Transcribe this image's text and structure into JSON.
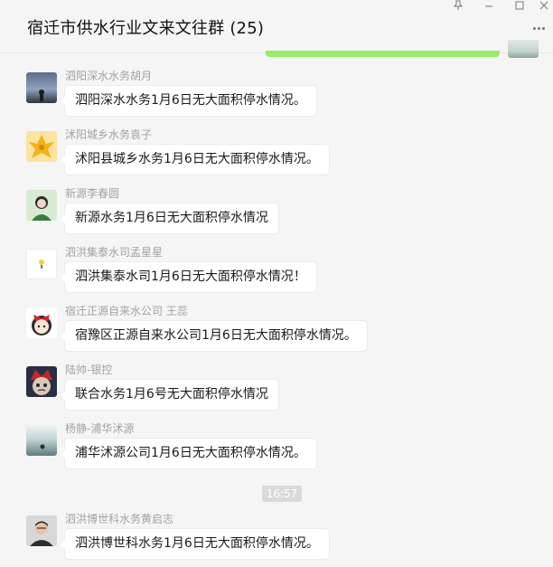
{
  "window": {
    "title": "宿迁市供水行业文来文往群 (25)",
    "controls": [
      "pin-icon",
      "minimize-icon",
      "maximize-icon",
      "close-icon"
    ],
    "more_icon": "more-dots-icon"
  },
  "colors": {
    "background": "#f5f5f5",
    "bubble_incoming": "#ffffff",
    "bubble_outgoing": "#95ec69",
    "sender_text": "#a3a3a3",
    "time_badge": "#dadada"
  },
  "messages": [
    {
      "sender": "泗阳深水水务胡月",
      "text": "泗阳深水水务1月6日无大面积停水情况。"
    },
    {
      "sender": "沭阳城乡水务袁子",
      "text": "沭阳县城乡水务1月6日无大面积停水情况。"
    },
    {
      "sender": "新源李春圆",
      "text": "新源水务1月6日无大面积停水情况"
    },
    {
      "sender": "泗洪集泰水司孟星星",
      "text": "泗洪集泰水司1月6日无大面积停水情况！"
    },
    {
      "sender": "宿迁正源自来水公司 王蕊",
      "text": "宿豫区正源自来水公司1月6日无大面积停水情况。"
    },
    {
      "sender": "陆帅-银控",
      "text": "联合水务1月6号无大面积停水情况"
    },
    {
      "sender": "杨静-浦华沭源",
      "text": "浦华沭源公司1月6日无大面积停水情况。"
    },
    {
      "sender": "泗洪博世科水务黄启志",
      "text": "泗洪博世科水务1月6日无大面积停水情况。"
    }
  ],
  "time_separator": "16:57"
}
